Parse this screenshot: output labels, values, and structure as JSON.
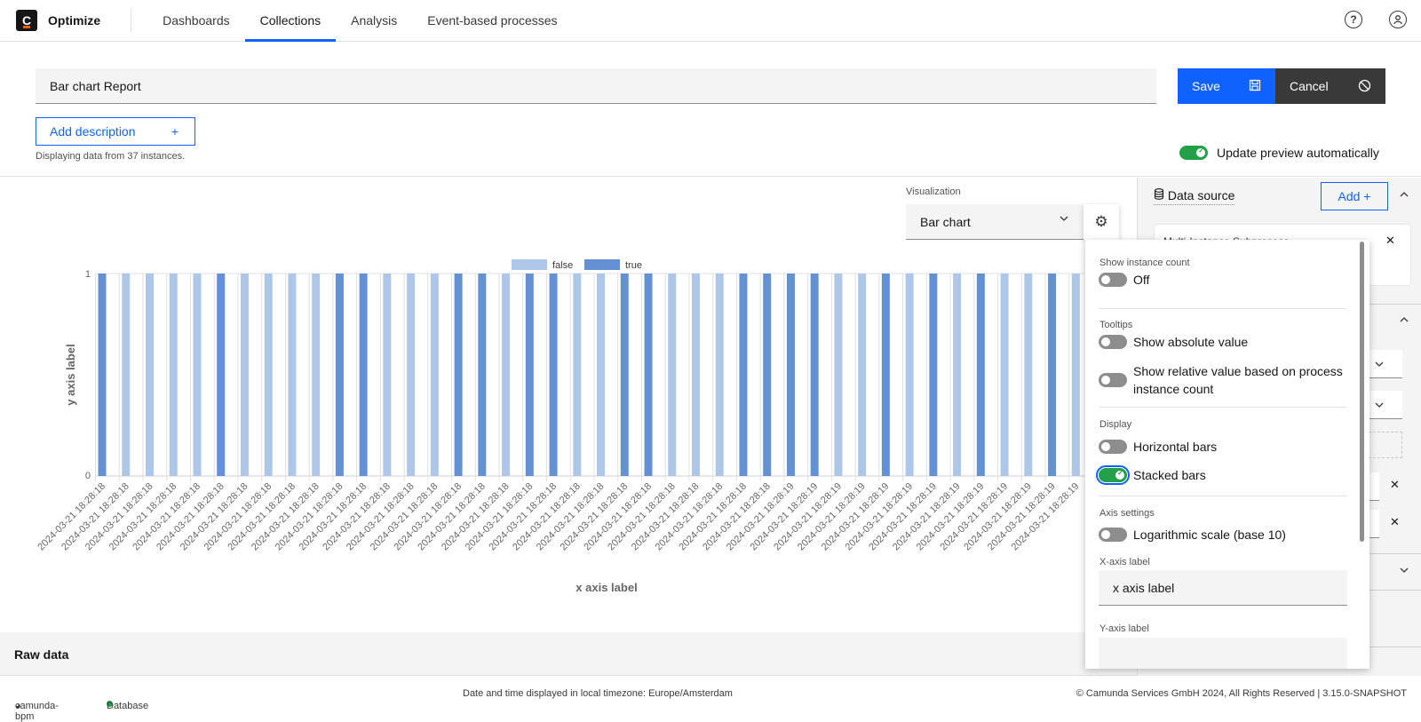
{
  "nav": {
    "logo_letter": "C",
    "brand": "Optimize",
    "tabs": [
      {
        "label": "Dashboards",
        "active": false
      },
      {
        "label": "Collections",
        "active": true
      },
      {
        "label": "Analysis",
        "active": false
      },
      {
        "label": "Event-based processes",
        "active": false
      }
    ],
    "help_icon": "?",
    "user_icon": "user-icon"
  },
  "header": {
    "report_name": "Bar chart Report",
    "save_label": "Save",
    "save_icon": "🖫",
    "cancel_label": "Cancel",
    "cancel_icon": "⃠",
    "add_description_label": "Add description",
    "add_description_icon": "+",
    "instances_text": "Displaying data from 37 instances.",
    "auto_preview_label": "Update preview automatically",
    "auto_preview_on": true
  },
  "visualization": {
    "label": "Visualization",
    "selected": "Bar chart",
    "gear_icon": "⚙"
  },
  "data_source": {
    "title": "Data source",
    "add_label": "Add +",
    "card_title": "Multi-Instance Subprocess"
  },
  "config_popover": {
    "show_instance_count": {
      "label": "Show instance count",
      "toggle_label": "Off",
      "on": false
    },
    "tooltips": {
      "label": "Tooltips",
      "absolute": {
        "label": "Show absolute value",
        "on": false
      },
      "relative_line1": "Show relative value based on process",
      "relative_line2": "instance count",
      "relative_on": false
    },
    "display": {
      "label": "Display",
      "horizontal": {
        "label": "Horizontal bars",
        "on": false
      },
      "stacked": {
        "label": "Stacked bars",
        "on": true
      }
    },
    "axis": {
      "label": "Axis settings",
      "log": {
        "label": "Logarithmic scale (base 10)",
        "on": false
      },
      "x_label_title": "X-axis label",
      "x_label_value": "x axis label",
      "y_label_title": "Y-axis label",
      "y_label_value": ""
    }
  },
  "raw_data_label": "Raw data",
  "footer": {
    "engine": "camunda-bpm",
    "db": "Database",
    "timezone": "Date and time displayed in local timezone: Europe/Amsterdam",
    "copyright": "© Camunda Services GmbH 2024, All Rights Reserved | 3.15.0-SNAPSHOT"
  },
  "colors": {
    "accent": "#0f62fe",
    "true_series": "#6391d4",
    "false_series": "#aec7e8",
    "toggle_on": "#24a148"
  },
  "chart_data": {
    "type": "bar",
    "stacked": true,
    "xlabel": "x axis label",
    "ylabel": "y axis label",
    "ylim": [
      0,
      1
    ],
    "yticks": [
      "0",
      "1"
    ],
    "legend": [
      "false",
      "true"
    ],
    "legend_position": "top-center",
    "grid": true,
    "categories": [
      "2024-03-21 18:28:18",
      "2024-03-21 18:28:18",
      "2024-03-21 18:28:18",
      "2024-03-21 18:28:18",
      "2024-03-21 18:28:18",
      "2024-03-21 18:28:18",
      "2024-03-21 18:28:18",
      "2024-03-21 18:28:18",
      "2024-03-21 18:28:18",
      "2024-03-21 18:28:18",
      "2024-03-21 18:28:18",
      "2024-03-21 18:28:18",
      "2024-03-21 18:28:18",
      "2024-03-21 18:28:18",
      "2024-03-21 18:28:18",
      "2024-03-21 18:28:18",
      "2024-03-21 18:28:18",
      "2024-03-21 18:28:18",
      "2024-03-21 18:28:18",
      "2024-03-21 18:28:18",
      "2024-03-21 18:28:18",
      "2024-03-21 18:28:18",
      "2024-03-21 18:28:18",
      "2024-03-21 18:28:18",
      "2024-03-21 18:28:18",
      "2024-03-21 18:28:18",
      "2024-03-21 18:28:18",
      "2024-03-21 18:28:18",
      "2024-03-21 18:28:18",
      "2024-03-21 18:28:19",
      "2024-03-21 18:28:19",
      "2024-03-21 18:28:19",
      "2024-03-21 18:28:19",
      "2024-03-21 18:28:19",
      "2024-03-21 18:28:19",
      "2024-03-21 18:28:19",
      "2024-03-21 18:28:19",
      "2024-03-21 18:28:19",
      "2024-03-21 18:28:19",
      "2024-03-21 18:28:19",
      "2024-03-21 18:28:19",
      "2024-03-21 18:28:19"
    ],
    "series": [
      {
        "name": "false",
        "values": [
          0,
          1,
          1,
          1,
          1,
          0,
          1,
          1,
          1,
          1,
          0,
          0,
          1,
          1,
          1,
          0,
          0,
          1,
          0,
          0,
          1,
          1,
          0,
          0,
          1,
          1,
          1,
          0,
          0,
          0,
          0,
          1,
          1,
          0,
          1,
          0,
          1,
          0,
          1,
          1,
          0,
          1
        ]
      },
      {
        "name": "true",
        "values": [
          1,
          0,
          0,
          0,
          0,
          1,
          0,
          0,
          0,
          0,
          1,
          1,
          0,
          0,
          0,
          1,
          1,
          0,
          1,
          1,
          0,
          0,
          1,
          1,
          0,
          0,
          0,
          1,
          1,
          1,
          1,
          0,
          0,
          1,
          0,
          1,
          0,
          1,
          0,
          0,
          1,
          0
        ]
      }
    ]
  }
}
